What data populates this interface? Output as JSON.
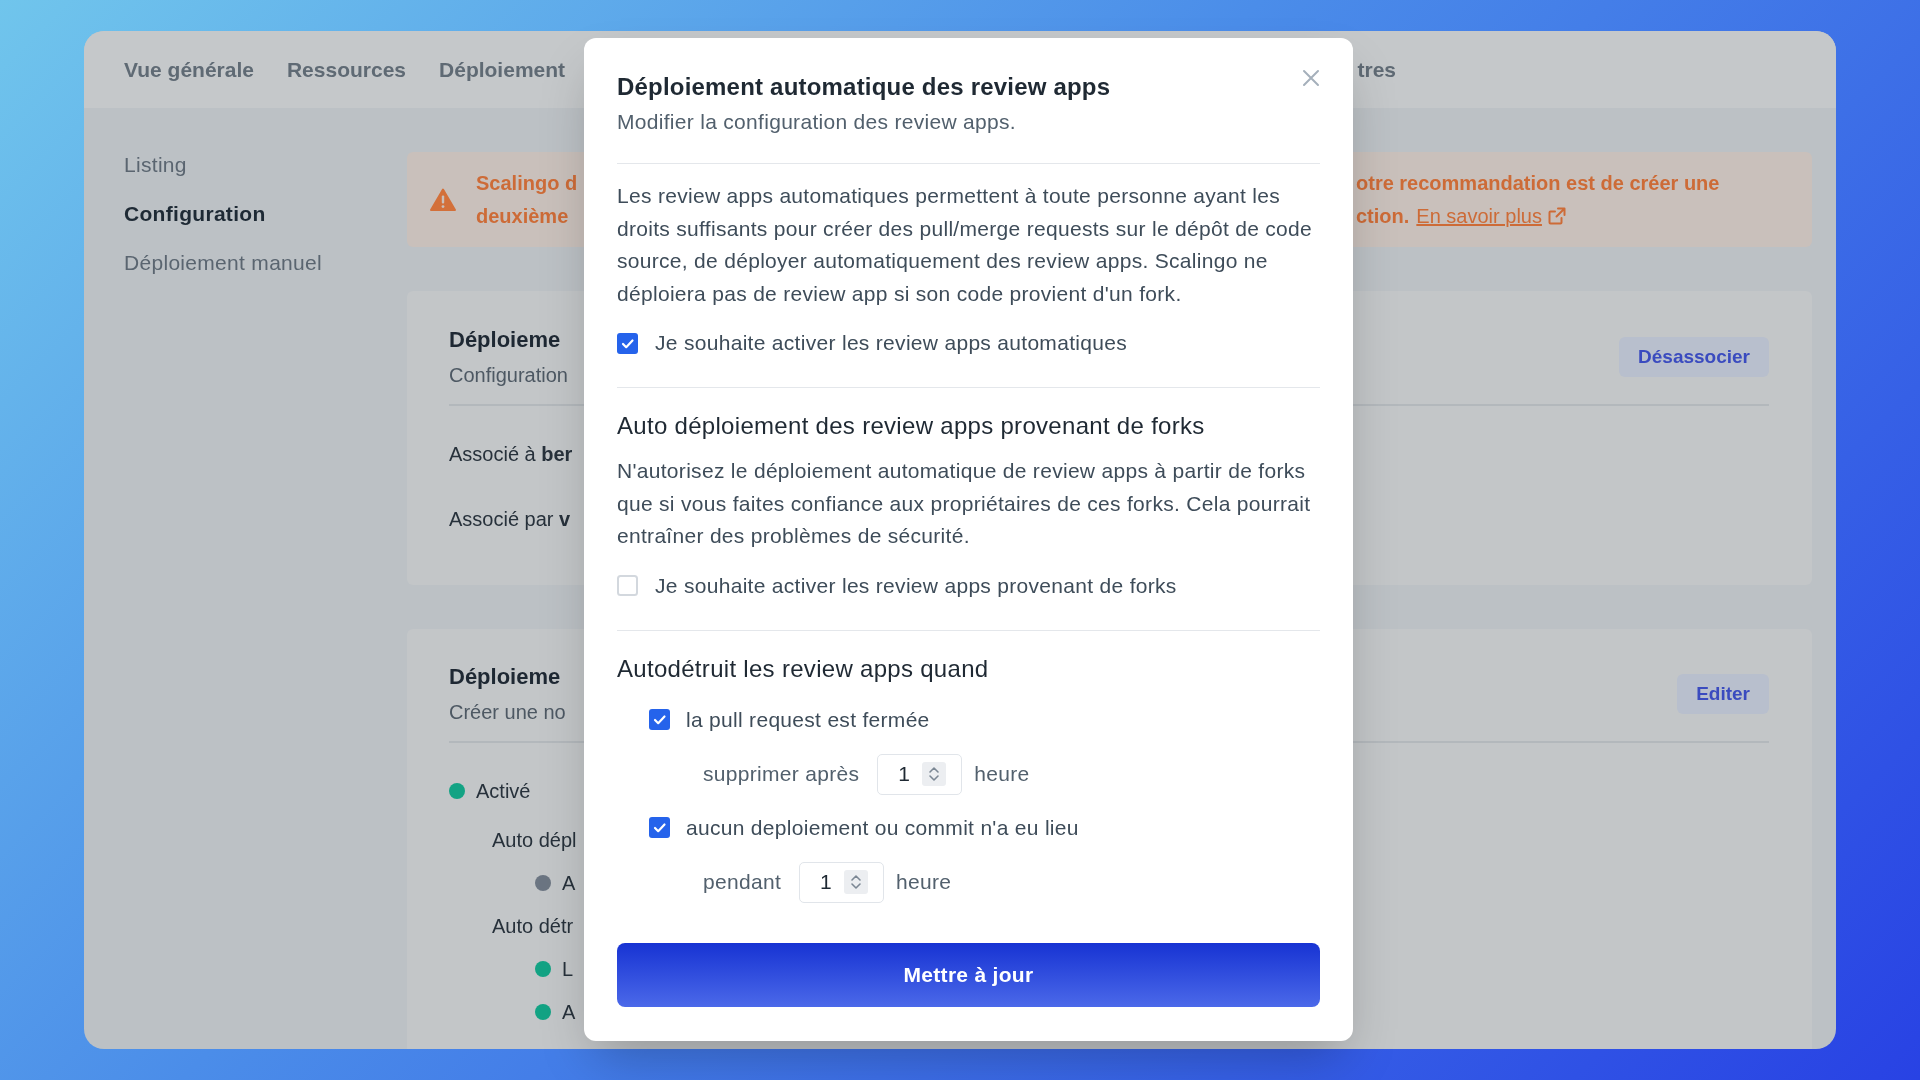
{
  "app": {
    "nav": [
      {
        "label": "Vue générale"
      },
      {
        "label": "Ressources"
      },
      {
        "label": "Déploiement"
      },
      {
        "label": "tres"
      }
    ],
    "sidebar": {
      "items": [
        {
          "label": "Listing",
          "selected": false
        },
        {
          "label": "Configuration",
          "selected": true
        },
        {
          "label": "Déploiement manuel",
          "selected": false
        }
      ]
    },
    "warning": {
      "left_lines": [
        "Scalingo d",
        "deuxième"
      ],
      "right_lines": [
        "otre recommandation est de créer une",
        "ction."
      ],
      "link": "En savoir plus"
    },
    "cards": [
      {
        "kind": "details",
        "title": "Déploieme",
        "subtitle": "Configuration",
        "button": "Désassocier",
        "rows": [
          "Associé à **ber**",
          "Associé par **v**"
        ]
      },
      {
        "kind": "status",
        "title": "Déploieme",
        "subtitle": "Créer une no",
        "button": "Editer",
        "items": [
          {
            "label": "Activé",
            "color": "#13a384",
            "children": [
              {
                "label": "Auto dépl",
                "children": [
                  {
                    "label": "A",
                    "color": "#6b7582"
                  }
                ]
              },
              {
                "label": "Auto détr",
                "children": [
                  {
                    "label": "L",
                    "color": "#13a384"
                  },
                  {
                    "label": "A",
                    "color": "#13a384"
                  }
                ]
              }
            ]
          }
        ]
      }
    ]
  },
  "modal": {
    "title": "Déploiement automatique des review apps",
    "subtitle": "Modifier la configuration des review apps.",
    "sections": [
      {
        "kind": "toggle",
        "description": "Les review apps automatiques permettent à toute personne ayant les droits suffisants pour créer des pull/merge requests sur le dépôt de code source, de déployer automatiquement des review apps. Scalingo ne déploiera pas de review app si son code provient d'un fork.",
        "checkbox": {
          "label": "Je souhaite activer les review apps automatiques",
          "checked": true
        }
      },
      {
        "kind": "toggle",
        "heading": "Auto déploiement des review apps provenant de forks",
        "description": "N'autorisez le déploiement automatique de review apps à partir de forks que si vous faites confiance aux propriétaires de ces forks. Cela pourrait entraîner des problèmes de sécurité.",
        "checkbox": {
          "label": "Je souhaite activer les review apps provenant de forks",
          "checked": false
        }
      },
      {
        "kind": "conditions",
        "heading": "Autodétruit les review apps quand",
        "conditions": [
          {
            "label": "la pull request est fermée",
            "checked": true,
            "field_label": "supprimer après",
            "value": "1",
            "unit": "heure"
          },
          {
            "label": "aucun deploiement ou commit n'a eu lieu",
            "checked": true,
            "field_label": "pendant",
            "value": "1",
            "unit": "heure"
          }
        ]
      }
    ],
    "submit": "Mettre à jour"
  }
}
